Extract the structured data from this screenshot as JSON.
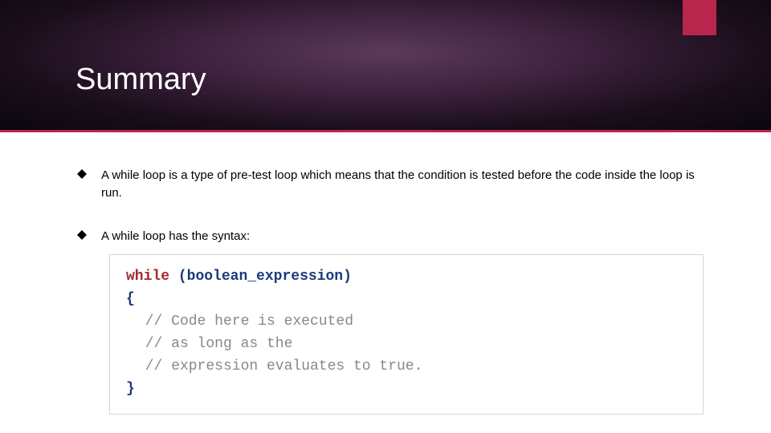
{
  "header": {
    "title": "Summary"
  },
  "bullets": [
    "A while loop is a type of pre-test loop which means that the condition is tested before the code inside the loop is run.",
    "A while loop has the syntax:"
  ],
  "code": {
    "keyword": "while",
    "open_paren": "(",
    "expr": "boolean_expression",
    "close_paren": ")",
    "open_brace": "{",
    "comment1": "// Code here is executed",
    "comment2": "// as long as the",
    "comment3": "// expression evaluates to true.",
    "close_brace": "}"
  }
}
